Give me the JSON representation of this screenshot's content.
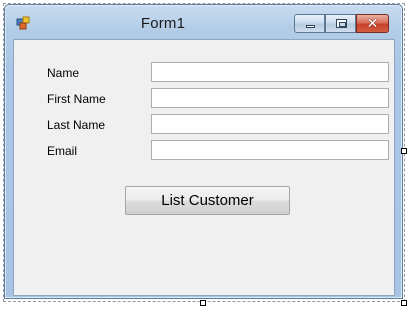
{
  "window": {
    "title": "Form1",
    "close_glyph": "✕",
    "icon": "winforms-form-icon"
  },
  "form": {
    "fields": [
      {
        "label": "Name",
        "value": ""
      },
      {
        "label": "First Name",
        "value": ""
      },
      {
        "label": "Last Name",
        "value": ""
      },
      {
        "label": "Email",
        "value": ""
      }
    ],
    "button_label": "List Customer"
  },
  "colors": {
    "client_background": "#f0f0f0",
    "frame_blue": "#a9c6e6",
    "close_red": "#c7412a"
  }
}
